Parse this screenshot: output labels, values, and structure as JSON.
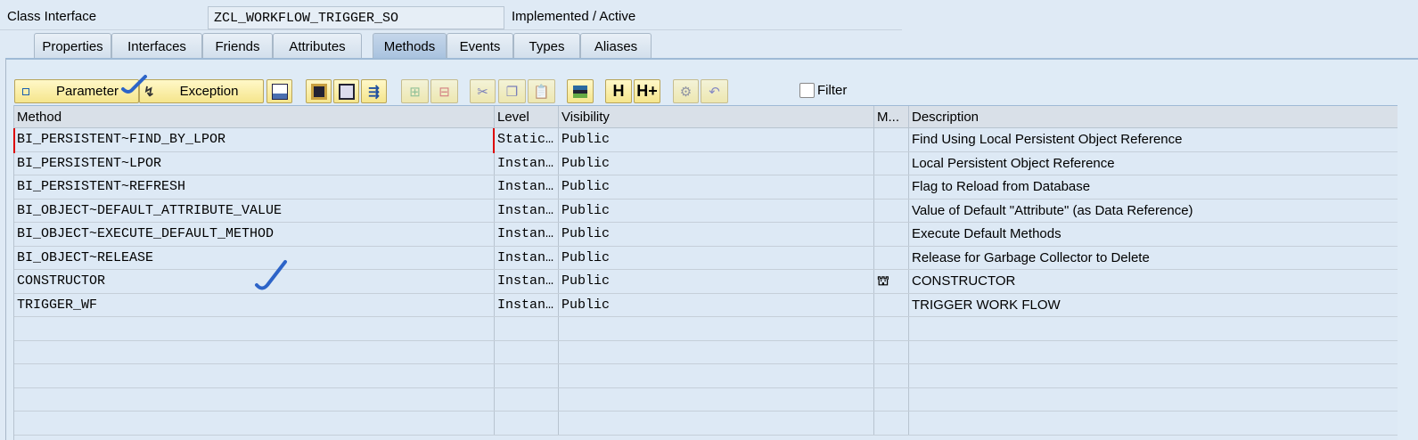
{
  "header": {
    "label": "Class Interface",
    "class_name": "ZCL_WORKFLOW_TRIGGER_SO",
    "status": "Implemented / Active"
  },
  "tabs": [
    "Properties",
    "Interfaces",
    "Friends",
    "Attributes",
    "Methods",
    "Events",
    "Types",
    "Aliases"
  ],
  "active_tab": "Methods",
  "toolbar": {
    "parameter": "Parameter",
    "exception": "Exception",
    "filter": "Filter"
  },
  "table": {
    "columns": [
      "Method",
      "Level",
      "Visibility",
      "M...",
      "Description"
    ],
    "rows": [
      {
        "method": "BI_PERSISTENT~FIND_BY_LPOR",
        "level": "Static…",
        "visibility": "Public",
        "m": "",
        "description": "Find Using Local Persistent Object Reference"
      },
      {
        "method": "BI_PERSISTENT~LPOR",
        "level": "Instan…",
        "visibility": "Public",
        "m": "",
        "description": "Local Persistent Object Reference"
      },
      {
        "method": "BI_PERSISTENT~REFRESH",
        "level": "Instan…",
        "visibility": "Public",
        "m": "",
        "description": "Flag to Reload from Database"
      },
      {
        "method": "BI_OBJECT~DEFAULT_ATTRIBUTE_VALUE",
        "level": "Instan…",
        "visibility": "Public",
        "m": "",
        "description": "Value of Default \"Attribute\" (as Data Reference)"
      },
      {
        "method": "BI_OBJECT~EXECUTE_DEFAULT_METHOD",
        "level": "Instan…",
        "visibility": "Public",
        "m": "",
        "description": "Execute Default Methods"
      },
      {
        "method": "BI_OBJECT~RELEASE",
        "level": "Instan…",
        "visibility": "Public",
        "m": "",
        "description": "Release for Garbage Collector to Delete"
      },
      {
        "method": "CONSTRUCTOR",
        "level": "Instan…",
        "visibility": "Public",
        "m": "constructor-icon",
        "description": "CONSTRUCTOR"
      },
      {
        "method": "TRIGGER_WF",
        "level": "Instan…",
        "visibility": "Public",
        "m": "",
        "description": "TRIGGER WORK FLOW"
      }
    ]
  }
}
